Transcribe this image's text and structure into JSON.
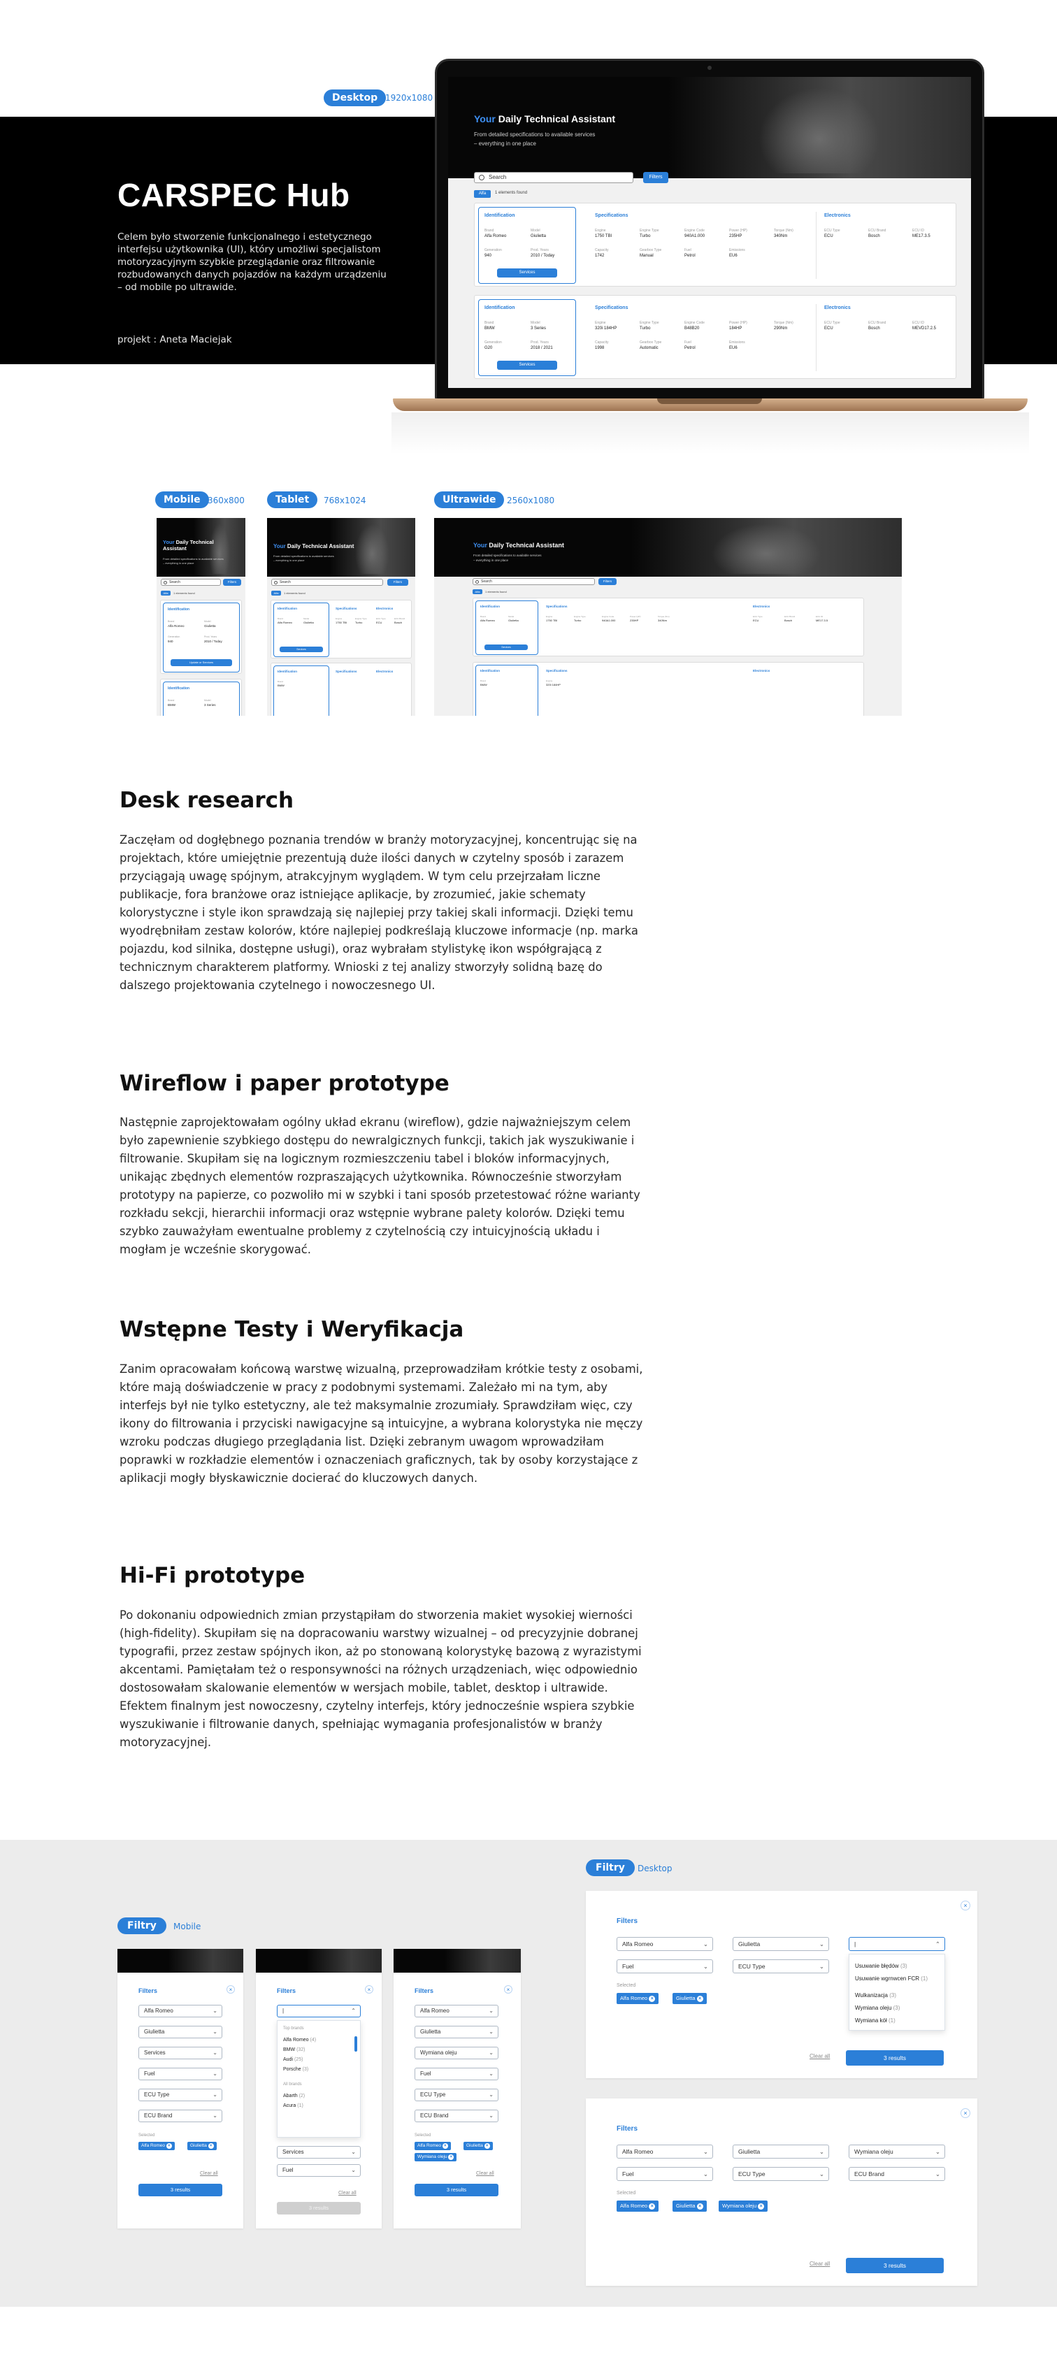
{
  "hero": {
    "title": "CARSPEC Hub",
    "description": "Celem było stworzenie funkcjonalnego i estetycznego interfejsu użytkownika (UI), który umożliwi specjalistom motoryzacyjnym szybkie przeglądanie oraz filtrowanie rozbudowanych danych pojazdów na każdym urządzeniu – od mobile po ultrawide.",
    "credit": "projekt : Aneta Maciejak",
    "desktop_pill": "Desktop",
    "desktop_res": "1920x1080"
  },
  "app": {
    "title_accent": "Your",
    "title_rest": "Daily Technical Assistant",
    "subtitle_1": "From detailed specifications to available services",
    "subtitle_2": "– everything in one place",
    "search_placeholder": "Search",
    "filters_button": "Filters",
    "tag": "Alfa",
    "found": "1 elements found",
    "sections": {
      "identification": "Identification",
      "specifications": "Specifications",
      "electronics": "Electronics"
    },
    "services_button": "Services",
    "card1": {
      "id_labels": [
        "Brand",
        "Model",
        "Generation",
        "Prod. Years"
      ],
      "id_values": [
        "Alfa Romeo",
        "Giulietta",
        "940",
        "2010 / Today"
      ],
      "spec_labels": [
        "Engine",
        "Engine Type",
        "Engine Code",
        "Power (HP)",
        "Torque (Nm)",
        "Capacity",
        "Gearbox Type",
        "Fuel",
        "Emissions"
      ],
      "spec_values": [
        "1750 TBI",
        "Turbo",
        "940A1.000",
        "235HP",
        "340Nm",
        "1742",
        "Manual",
        "Petrol",
        "EU6"
      ],
      "elec_labels": [
        "ECU Type",
        "ECU Brand",
        "ECU ID"
      ],
      "elec_values": [
        "ECU",
        "Bosch",
        "ME17.3.5"
      ]
    },
    "card2": {
      "id_labels": [
        "Brand",
        "Model",
        "Generation",
        "Prod. Years"
      ],
      "id_values": [
        "BMW",
        "3 Series",
        "G20",
        "2018 / 2021"
      ],
      "spec_labels": [
        "Engine",
        "Engine Type",
        "Engine Code",
        "Power (HP)",
        "Torque (Nm)",
        "Capacity",
        "Gearbox Type",
        "Fuel",
        "Emissions"
      ],
      "spec_values": [
        "320i 184HP",
        "Turbo",
        "B48B20",
        "184HP",
        "290Nm",
        "1998",
        "Automatic",
        "Petrol",
        "EU6"
      ],
      "elec_labels": [
        "ECU Type",
        "ECU Brand",
        "ECU ID"
      ],
      "elec_values": [
        "ECU",
        "Bosch",
        "MEVD17.2.5"
      ]
    }
  },
  "devices": [
    {
      "pill": "Mobile",
      "res": "360x800"
    },
    {
      "pill": "Tablet",
      "res": "768x1024"
    },
    {
      "pill": "Ultrawide",
      "res": "2560x1080"
    }
  ],
  "mobile_card_button": "Update or Services",
  "article": [
    {
      "heading": "Desk research",
      "body": "Zaczęłam od dogłębnego poznania trendów w branży motoryzacyjnej, koncentrując się na projektach, które umiejętnie prezentują duże ilości danych w czytelny sposób i zarazem przyciągają uwagę spójnym, atrakcyjnym wyglądem. W tym celu przejrzałam liczne publikacje, fora branżowe oraz istniejące aplikacje, by zrozumieć, jakie schematy kolorystyczne i style ikon sprawdzają się najlepiej przy takiej skali informacji. Dzięki temu wyodrębniłam zestaw kolorów, które najlepiej podkreślają kluczowe informacje (np. marka pojazdu, kod silnika, dostępne usługi), oraz wybrałam stylistykę ikon współgrającą z technicznym charakterem platformy. Wnioski z tej analizy stworzyły solidną bazę do dalszego projektowania czytelnego i nowoczesnego UI."
    },
    {
      "heading": "Wireflow i paper prototype",
      "body": "Następnie zaprojektowałam ogólny układ ekranu (wireflow), gdzie najważniejszym celem było zapewnienie szybkiego dostępu do newralgicznych funkcji, takich jak wyszukiwanie i filtrowanie. Skupiłam się na logicznym rozmieszczeniu tabel i bloków informacyjnych, unikając zbędnych elementów rozpraszających użytkownika. Równocześnie stworzyłam prototypy na papierze, co pozwoliło mi w szybki i tani sposób przetestować różne warianty rozkładu sekcji, hierarchii informacji oraz wstępnie wybrane palety kolorów. Dzięki temu szybko zauważyłam ewentualne problemy z czytelnością czy intuicyjnością układu i mogłam je wcześnie skorygować."
    },
    {
      "heading": "Wstępne Testy i Weryfikacja",
      "body": "Zanim opracowałam końcową warstwę wizualną, przeprowadziłam krótkie testy z osobami, które mają doświadczenie w pracy z podobnymi systemami. Zależało mi na tym, aby interfejs był nie tylko estetyczny, ale też maksymalnie zrozumiały. Sprawdziłam więc, czy ikony do filtrowania i przyciski nawigacyjne są intuicyjne, a wybrana kolorystyka nie męczy wzroku podczas długiego przeglądania list. Dzięki zebranym uwagom wprowadziłam poprawki w rozkładzie elementów i oznaczeniach graficznych, tak by osoby korzystające z aplikacji mogły błyskawicznie docierać do kluczowych danych."
    },
    {
      "heading": "Hi-Fi prototype",
      "body": "Po dokonaniu odpowiednich zmian przystąpiłam do stworzenia makiet wysokiej wierności (high-fidelity). Skupiłam się na dopracowaniu warstwy wizualnej – od precyzyjnie dobranej typografii, przez zestaw spójnych ikon, aż po stonowaną kolorystykę bazową z wyrazistymi akcentami. Pamiętałam też o responsywności na różnych urządzeniach, więc odpowiednio dostosowałam skalowanie elementów w wersjach mobile, tablet, desktop i ultrawide. Efektem finalnym jest nowoczesny, czytelny interfejs, który jednocześnie wspiera szybkie wyszukiwanie i filtrowanie danych, spełniając wymagania profesjonalistów w branży motoryzacyjnej."
    }
  ],
  "filters": {
    "mobile_pill": "Filtry",
    "mobile_label": "Mobile",
    "desktop_pill": "Filtry",
    "desktop_label": "Desktop",
    "title": "Filters",
    "selected_label": "Selected",
    "clear_all": "Clear all",
    "results": "3 results",
    "selects": {
      "brand": "Alfa Romeo",
      "model": "Giulietta",
      "services": "Services",
      "service_selected": "Wymiana oleju",
      "fuel": "Fuel",
      "ecu_type": "ECU Type",
      "ecu_brand": "ECU Brand",
      "pending": "|"
    },
    "chips": {
      "brand": "Alfa Romeo",
      "model": "Giulietta",
      "service": "Wymiana oleju"
    },
    "mobile_dropdown": {
      "group1": "Top brands",
      "options1": [
        {
          "name": "Alfa Romeo",
          "count": "(4)"
        },
        {
          "name": "BMW",
          "count": "(32)"
        },
        {
          "name": "Audi",
          "count": "(25)"
        },
        {
          "name": "Porsche",
          "count": "(3)"
        }
      ],
      "group2": "All brands",
      "options2": [
        {
          "name": "Abarth",
          "count": "(2)"
        },
        {
          "name": "Acura",
          "count": "(1)"
        }
      ]
    },
    "desktop_dropdown": [
      {
        "name": "Usuwanie błędów",
        "count": "(3)"
      },
      {
        "name": "Usuwanie wgrnwcen FCR",
        "count": "(1)"
      },
      {
        "name": "Wulkanizacja",
        "count": "(3)"
      },
      {
        "name": "Wymiana oleju",
        "count": "(3)"
      },
      {
        "name": "Wymiana kół",
        "count": "(1)"
      }
    ]
  }
}
